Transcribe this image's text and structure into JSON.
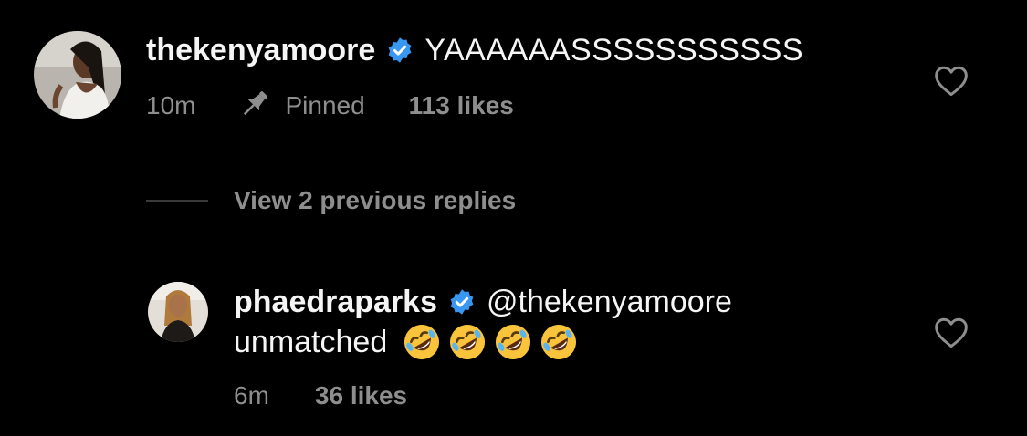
{
  "colors": {
    "background": "#000000",
    "text_primary": "#f5f5f5",
    "text_secondary": "#8e8e8e",
    "verified": "#3897f0"
  },
  "comments": [
    {
      "username": "thekenyamoore",
      "verified": true,
      "text": "YAAAAAASSSSSSSSSSS",
      "time": "10m",
      "pinned_label": "Pinned",
      "likes": "113 likes",
      "icons": [
        "avatar",
        "verified-badge-icon",
        "pin-icon",
        "heart-icon"
      ]
    }
  ],
  "replies_toggle": {
    "label": "View 2 previous replies"
  },
  "replies": [
    {
      "username": "phaedraparks",
      "verified": true,
      "mention": "@thekenyamoore",
      "text": "unmatched",
      "emojis": [
        "rolling-on-floor-laughing-emoji",
        "rolling-on-floor-laughing-emoji",
        "rolling-on-floor-laughing-emoji",
        "rolling-on-floor-laughing-emoji"
      ],
      "time": "6m",
      "likes": "36 likes",
      "icons": [
        "avatar",
        "verified-badge-icon",
        "heart-icon"
      ]
    }
  ]
}
